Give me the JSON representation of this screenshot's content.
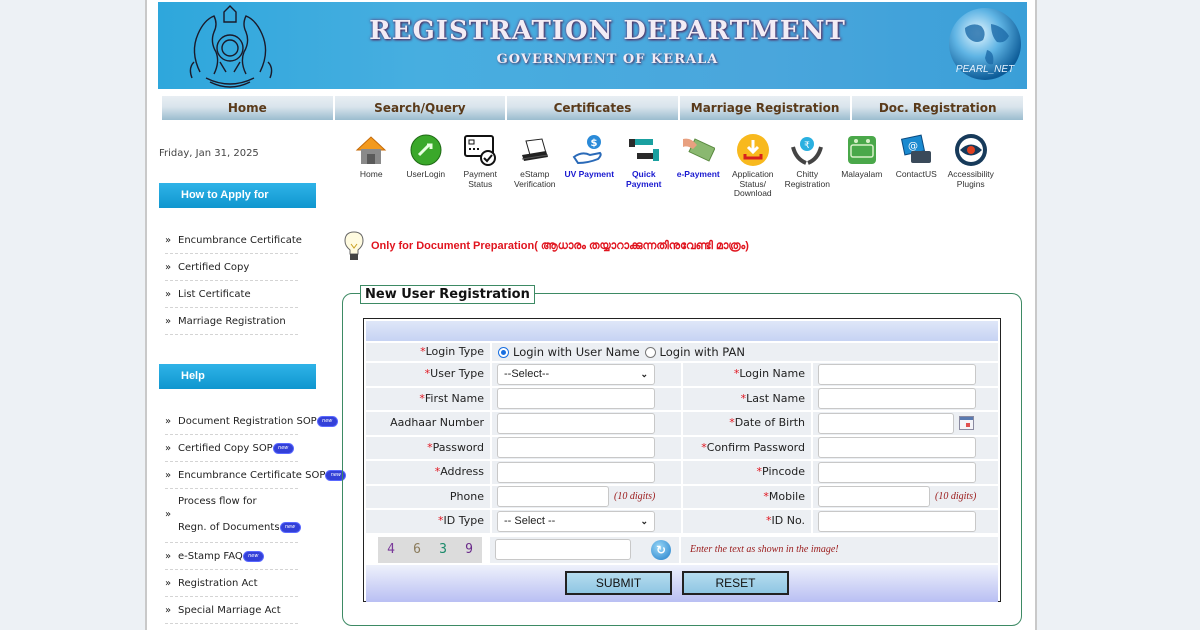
{
  "header": {
    "title": "REGISTRATION DEPARTMENT",
    "subtitle": "GOVERNMENT OF KERALA",
    "globe_label": "PEARL_NET"
  },
  "nav": [
    {
      "label": "Home"
    },
    {
      "label": "Search/Query"
    },
    {
      "label": "Certificates"
    },
    {
      "label": "Marriage Registration"
    },
    {
      "label": "Doc. Registration"
    }
  ],
  "date": "Friday, Jan 31, 2025",
  "sidebar": {
    "how_to_apply": {
      "heading": "How to Apply for",
      "items": [
        {
          "label": "Encumbrance Certificate"
        },
        {
          "label": "Certified Copy"
        },
        {
          "label": "List Certificate"
        },
        {
          "label": "Marriage Registration"
        }
      ]
    },
    "help": {
      "heading": "Help",
      "items": [
        {
          "label": "Document Registration SOP",
          "new": true
        },
        {
          "label": "Certified Copy SOP",
          "new": true
        },
        {
          "label": "Encumbrance Certificate SOP",
          "new": true
        },
        {
          "label": "Process flow for",
          "label2": "Regn. of Documents",
          "new": true
        },
        {
          "label": "e-Stamp FAQ",
          "new": true
        },
        {
          "label": "Registration Act"
        },
        {
          "label": "Special Marriage Act"
        }
      ]
    },
    "new_badge": "new"
  },
  "quick_icons": [
    {
      "label": "Home",
      "icon": "home-icon"
    },
    {
      "label": "UserLogin",
      "icon": "key-icon"
    },
    {
      "label": "Payment Status",
      "icon": "payment-card-icon"
    },
    {
      "label": "eStamp Verification",
      "icon": "stamp-paper-icon"
    },
    {
      "label": "UV Payment",
      "icon": "dollar-hand-icon",
      "highlight": true
    },
    {
      "label": "Quick Payment",
      "icon": "cash-transfer-icon",
      "highlight": true
    },
    {
      "label": "e-Payment",
      "icon": "cash-hand-icon",
      "highlight": true
    },
    {
      "label": "Application Status/ Download",
      "icon": "download-icon"
    },
    {
      "label": "Chitty Registration",
      "icon": "rupee-bag-icon"
    },
    {
      "label": "Malayalam",
      "icon": "malayalam-keyboard-icon"
    },
    {
      "label": "ContactUS",
      "icon": "contact-phone-icon"
    },
    {
      "label": "Accessibility Plugins",
      "icon": "eye-icon"
    }
  ],
  "notice": "Only for Document Preparation( ആധാരം തയ്യാറാക്കുന്നതിനുവേണ്ടി മാത്രം)",
  "form": {
    "legend": "New User Registration",
    "required_mark": "*",
    "login_type": {
      "label": "Login Type",
      "options": [
        {
          "label": "Login with User Name",
          "selected": true
        },
        {
          "label": "Login with PAN",
          "selected": false
        }
      ]
    },
    "user_type": {
      "label": "User Type",
      "value": "--Select--"
    },
    "login_name": {
      "label": "Login Name",
      "value": ""
    },
    "first_name": {
      "label": "First Name",
      "value": ""
    },
    "last_name": {
      "label": "Last Name",
      "value": ""
    },
    "aadhaar": {
      "label": "Aadhaar Number",
      "value": ""
    },
    "dob": {
      "label": "Date of Birth",
      "value": ""
    },
    "password": {
      "label": "Password",
      "value": ""
    },
    "confirm_password": {
      "label": "Confirm Password",
      "value": ""
    },
    "address": {
      "label": "Address",
      "value": ""
    },
    "pincode": {
      "label": "Pincode",
      "value": ""
    },
    "phone": {
      "label": "Phone",
      "value": "",
      "hint": "(10 digits)"
    },
    "mobile": {
      "label": "Mobile",
      "value": "",
      "hint": "(10 digits)"
    },
    "id_type": {
      "label": "ID Type",
      "value": "-- Select --"
    },
    "id_no": {
      "label": "ID No.",
      "value": ""
    },
    "captcha": {
      "chars": [
        "4",
        "6",
        "3",
        "9"
      ],
      "colors": [
        "#7a3a9a",
        "#8a7a5a",
        "#1a8a6a",
        "#6a2a8a"
      ],
      "hint": "Enter the text as shown in the image!",
      "value": ""
    },
    "submit_label": "SUBMIT",
    "reset_label": "RESET"
  }
}
